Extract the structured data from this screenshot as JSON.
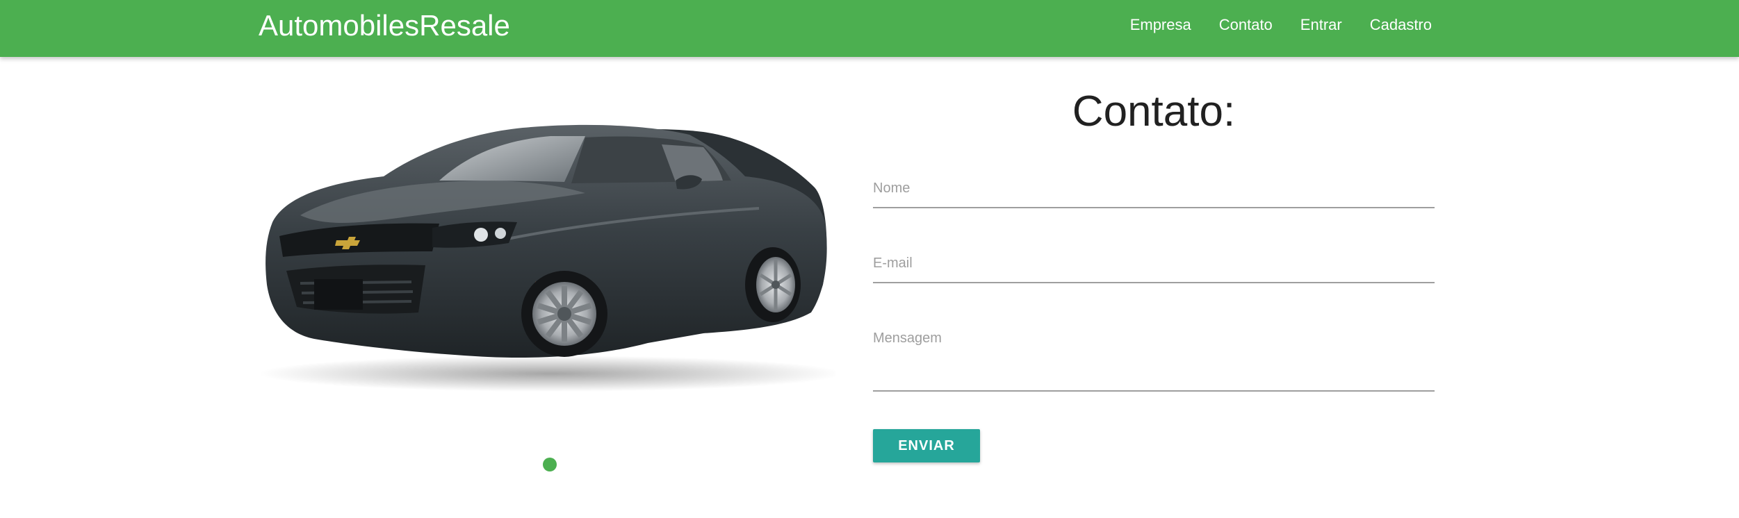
{
  "brand": "AutomobilesResale",
  "nav": {
    "items": [
      {
        "label": "Empresa"
      },
      {
        "label": "Contato"
      },
      {
        "label": "Entrar"
      },
      {
        "label": "Cadastro"
      }
    ]
  },
  "carousel": {
    "image_subject": "dark grey sports coupe",
    "indicator_count": 1
  },
  "form": {
    "title": "Contato:",
    "fields": {
      "name_label": "Nome",
      "email_label": "E-mail",
      "message_label": "Mensagem"
    },
    "submit_label": "ENVIAR"
  },
  "colors": {
    "navbar": "#4caf50",
    "button": "#26a69a",
    "indicator": "#4caf50"
  }
}
